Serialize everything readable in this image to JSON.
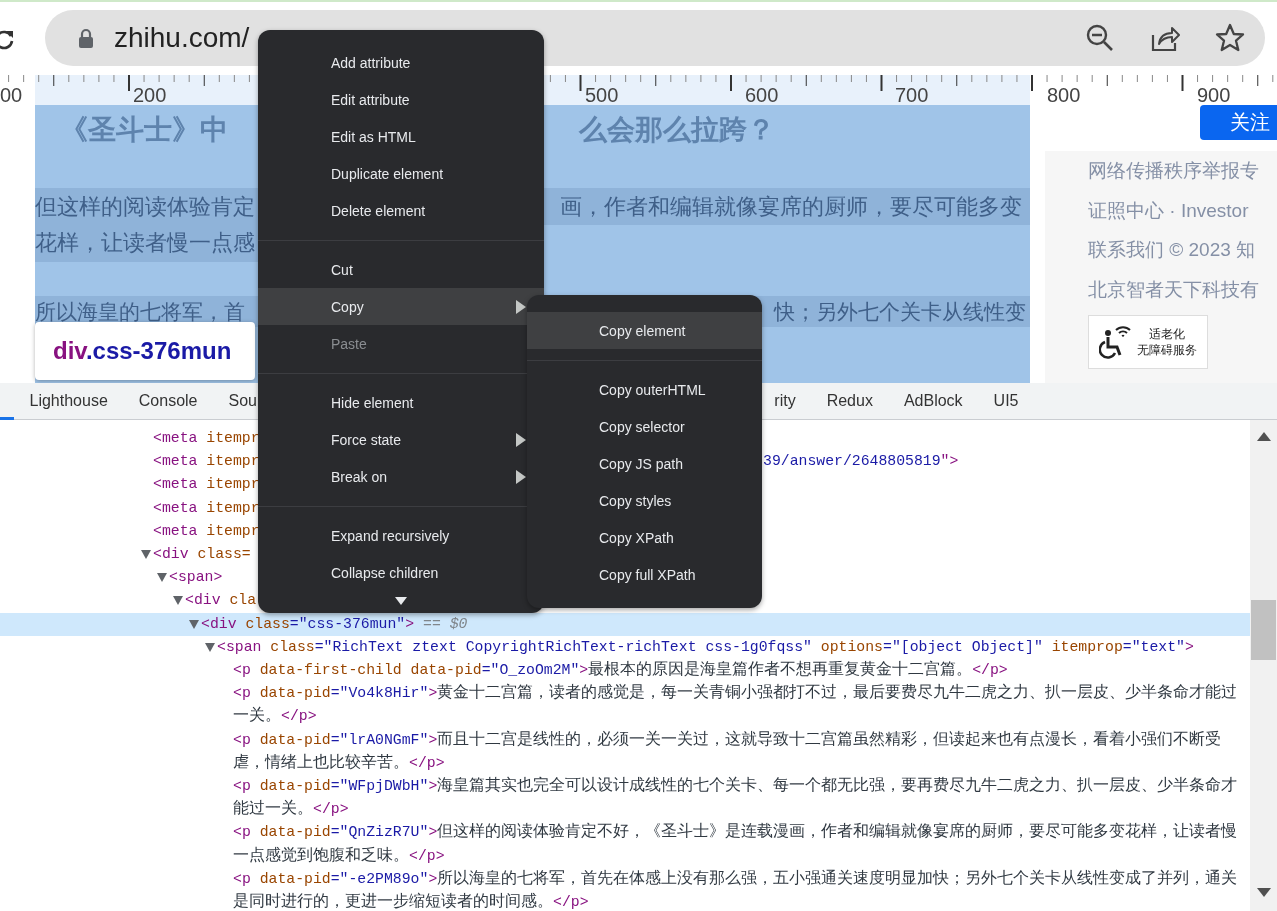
{
  "browser": {
    "url": "zhihu.com/"
  },
  "ruler": {
    "labels": [
      "00",
      "200",
      "500",
      "600",
      "700",
      "800",
      "900"
    ]
  },
  "page": {
    "title_fragments": [
      "《圣斗士》中",
      "么会那么拉跨？"
    ],
    "lines": [
      {
        "left": "但这样的阅读体验肯定",
        "right": "画，作者和编辑就像宴席的厨师，要尽可能多变"
      },
      {
        "left": "花样，让读者慢一点感"
      },
      {
        "left": "所以海皇的七将军，首",
        "right": "快；另外七个关卡从线性变"
      }
    ],
    "tooltip": {
      "tag": "div",
      "class_name": ".css-376mun"
    },
    "follow_button": "关注",
    "sidebar_links": [
      "网络传播秩序举报专",
      "证照中心 · Investor",
      "联系我们 © 2023 知",
      "北京智者天下科技有"
    ],
    "badge": {
      "line_1": "适老化",
      "line_2": "无障碍服务"
    }
  },
  "devtools": {
    "tabs_left": [
      {
        "label": "Lighthouse",
        "selected": false
      },
      {
        "label": "Console",
        "selected": false
      },
      {
        "label": "Sou",
        "selected": false
      }
    ],
    "tabs_right": [
      {
        "label": "rity",
        "selected": false
      },
      {
        "label": "Redux",
        "selected": false
      },
      {
        "label": "AdBlock",
        "selected": false
      },
      {
        "label": "UI5",
        "selected": false
      }
    ],
    "tree": [
      {
        "selected": false,
        "parts": [
          {
            "kind": "tag",
            "text": "<meta"
          },
          {
            "kind": "attr",
            "text": " itempr"
          }
        ]
      },
      {
        "selected": false,
        "parts": [
          {
            "kind": "tag",
            "text": "<meta"
          },
          {
            "kind": "attr",
            "text": " itempr"
          }
        ],
        "tail": [
          {
            "kind": "value",
            "text": "39/answer/2648805819"
          },
          {
            "kind": "tag",
            "text": "\">"
          }
        ]
      },
      {
        "selected": false,
        "parts": [
          {
            "kind": "tag",
            "text": "<meta"
          },
          {
            "kind": "attr",
            "text": " itempr"
          }
        ]
      },
      {
        "selected": false,
        "parts": [
          {
            "kind": "tag",
            "text": "<meta"
          },
          {
            "kind": "attr",
            "text": " itempr"
          }
        ]
      },
      {
        "selected": false,
        "parts": [
          {
            "kind": "tag",
            "text": "<meta"
          },
          {
            "kind": "attr",
            "text": " itempr"
          }
        ]
      },
      {
        "selected": false,
        "expanded": true,
        "parts": [
          {
            "kind": "tag",
            "text": "<div"
          },
          {
            "kind": "attr",
            "text": " class="
          }
        ],
        "children": [
          {
            "selected": false,
            "expanded": true,
            "parts": [
              {
                "kind": "tag",
                "text": "<span>"
              }
            ],
            "children": [
              {
                "selected": false,
                "expanded": true,
                "parts": [
                  {
                    "kind": "tag",
                    "text": "<div"
                  },
                  {
                    "kind": "attr",
                    "text": " cla"
                  }
                ],
                "children": [
                  {
                    "selected": true,
                    "expanded": true,
                    "parts": [
                      {
                        "kind": "tag",
                        "text": "<div"
                      },
                      {
                        "kind": "attr",
                        "text": " class"
                      },
                      {
                        "kind": "value",
                        "text": "=\"css-376mun\""
                      },
                      {
                        "kind": "tag",
                        "text": ">"
                      },
                      {
                        "kind": "ref",
                        "text": " == $0"
                      }
                    ],
                    "children": [
                      {
                        "selected": false,
                        "expanded": true,
                        "parts": [
                          {
                            "kind": "tag",
                            "text": "<span"
                          },
                          {
                            "kind": "attr",
                            "text": " class"
                          },
                          {
                            "kind": "value",
                            "text": "=\"RichText ztext CopyrightRichText-richText css-1g0fqss\""
                          },
                          {
                            "kind": "attr",
                            "text": " options"
                          },
                          {
                            "kind": "value",
                            "text": "=\"[object Object]\""
                          },
                          {
                            "kind": "attr",
                            "text": " itemprop"
                          },
                          {
                            "kind": "value",
                            "text": "=\"text\""
                          },
                          {
                            "kind": "tag",
                            "text": ">"
                          }
                        ],
                        "children": [
                          {
                            "selected": false,
                            "parts": [
                              {
                                "kind": "tag",
                                "text": "<p"
                              },
                              {
                                "kind": "attr",
                                "text": " data-first-child data-pid"
                              },
                              {
                                "kind": "value",
                                "text": "=\"O_zoOm2M\""
                              },
                              {
                                "kind": "tag",
                                "text": ">"
                              },
                              {
                                "kind": "text",
                                "text": "最根本的原因是海皇篇作者不想再重复黄金十二宫篇。"
                              },
                              {
                                "kind": "tag",
                                "text": "</p>"
                              }
                            ]
                          },
                          {
                            "selected": false,
                            "parts": [
                              {
                                "kind": "tag",
                                "text": "<p"
                              },
                              {
                                "kind": "attr",
                                "text": " data-pid"
                              },
                              {
                                "kind": "value",
                                "text": "=\"Vo4k8Hir\""
                              },
                              {
                                "kind": "tag",
                                "text": ">"
                              },
                              {
                                "kind": "text",
                                "text": "黄金十二宫篇，读者的感觉是，每一关青铜小强都打不过，最后要费尽九牛二虎之力、扒一层皮、少半条命才能过一关。"
                              },
                              {
                                "kind": "tag",
                                "text": "</p>"
                              }
                            ]
                          },
                          {
                            "selected": false,
                            "parts": [
                              {
                                "kind": "tag",
                                "text": "<p"
                              },
                              {
                                "kind": "attr",
                                "text": " data-pid"
                              },
                              {
                                "kind": "value",
                                "text": "=\"lrA0NGmF\""
                              },
                              {
                                "kind": "tag",
                                "text": ">"
                              },
                              {
                                "kind": "text",
                                "text": "而且十二宫是线性的，必须一关一关过，这就导致十二宫篇虽然精彩，但读起来也有点漫长，看着小强们不断受虐，情绪上也比较辛苦。"
                              },
                              {
                                "kind": "tag",
                                "text": "</p>"
                              }
                            ]
                          },
                          {
                            "selected": false,
                            "parts": [
                              {
                                "kind": "tag",
                                "text": "<p"
                              },
                              {
                                "kind": "attr",
                                "text": " data-pid"
                              },
                              {
                                "kind": "value",
                                "text": "=\"WFpjDWbH\""
                              },
                              {
                                "kind": "tag",
                                "text": ">"
                              },
                              {
                                "kind": "text",
                                "text": "海皇篇其实也完全可以设计成线性的七个关卡、每一个都无比强，要再费尽九牛二虎之力、扒一层皮、少半条命才能过一关。"
                              },
                              {
                                "kind": "tag",
                                "text": "</p>"
                              }
                            ]
                          },
                          {
                            "selected": false,
                            "parts": [
                              {
                                "kind": "tag",
                                "text": "<p"
                              },
                              {
                                "kind": "attr",
                                "text": " data-pid"
                              },
                              {
                                "kind": "value",
                                "text": "=\"QnZizR7U\""
                              },
                              {
                                "kind": "tag",
                                "text": ">"
                              },
                              {
                                "kind": "text",
                                "text": "但这样的阅读体验肯定不好，《圣斗士》是连载漫画，作者和编辑就像宴席的厨师，要尽可能多变花样，让读者慢一点感觉到饱腹和乏味。"
                              },
                              {
                                "kind": "tag",
                                "text": "</p>"
                              }
                            ]
                          },
                          {
                            "selected": false,
                            "parts": [
                              {
                                "kind": "tag",
                                "text": "<p"
                              },
                              {
                                "kind": "attr",
                                "text": " data-pid"
                              },
                              {
                                "kind": "value",
                                "text": "=\"-e2PM89o\""
                              },
                              {
                                "kind": "tag",
                                "text": ">"
                              },
                              {
                                "kind": "text",
                                "text": "所以海皇的七将军，首先在体感上没有那么强，五小强通关速度明显加快；另外七个关卡从线性变成了并列，通关是同时进行的，更进一步缩短读者的时间感。"
                              },
                              {
                                "kind": "tag",
                                "text": "</p>"
                              }
                            ]
                          }
                        ]
                      }
                    ]
                  }
                ]
              }
            ]
          }
        ]
      }
    ]
  },
  "context_menu": {
    "items": [
      {
        "kind": "item",
        "label": "Add attribute",
        "selected": false,
        "disabled": false,
        "submenu": false
      },
      {
        "kind": "item",
        "label": "Edit attribute",
        "selected": false,
        "disabled": false,
        "submenu": false
      },
      {
        "kind": "item",
        "label": "Edit as HTML",
        "selected": false,
        "disabled": false,
        "submenu": false
      },
      {
        "kind": "item",
        "label": "Duplicate element",
        "selected": false,
        "disabled": false,
        "submenu": false
      },
      {
        "kind": "item",
        "label": "Delete element",
        "selected": false,
        "disabled": false,
        "submenu": false
      },
      {
        "kind": "separator"
      },
      {
        "kind": "item",
        "label": "Cut",
        "selected": false,
        "disabled": false,
        "submenu": false
      },
      {
        "kind": "item",
        "label": "Copy",
        "selected": true,
        "disabled": false,
        "submenu": true
      },
      {
        "kind": "item",
        "label": "Paste",
        "selected": false,
        "disabled": true,
        "submenu": false
      },
      {
        "kind": "separator"
      },
      {
        "kind": "item",
        "label": "Hide element",
        "selected": false,
        "disabled": false,
        "submenu": false
      },
      {
        "kind": "item",
        "label": "Force state",
        "selected": false,
        "disabled": false,
        "submenu": true
      },
      {
        "kind": "item",
        "label": "Break on",
        "selected": false,
        "disabled": false,
        "submenu": true
      },
      {
        "kind": "separator"
      },
      {
        "kind": "item",
        "label": "Expand recursively",
        "selected": false,
        "disabled": false,
        "submenu": false
      },
      {
        "kind": "item",
        "label": "Collapse children",
        "selected": false,
        "disabled": false,
        "submenu": false
      }
    ]
  },
  "submenu": {
    "items": [
      {
        "kind": "item",
        "label": "Copy element",
        "selected": true,
        "disabled": false,
        "submenu": false
      },
      {
        "kind": "separator"
      },
      {
        "kind": "item",
        "label": "Copy outerHTML",
        "selected": false,
        "disabled": false,
        "submenu": false
      },
      {
        "kind": "item",
        "label": "Copy selector",
        "selected": false,
        "disabled": false,
        "submenu": false
      },
      {
        "kind": "item",
        "label": "Copy JS path",
        "selected": false,
        "disabled": false,
        "submenu": false
      },
      {
        "kind": "item",
        "label": "Copy styles",
        "selected": false,
        "disabled": false,
        "submenu": false
      },
      {
        "kind": "item",
        "label": "Copy XPath",
        "selected": false,
        "disabled": false,
        "submenu": false
      },
      {
        "kind": "item",
        "label": "Copy full XPath",
        "selected": false,
        "disabled": false,
        "submenu": false
      }
    ]
  }
}
